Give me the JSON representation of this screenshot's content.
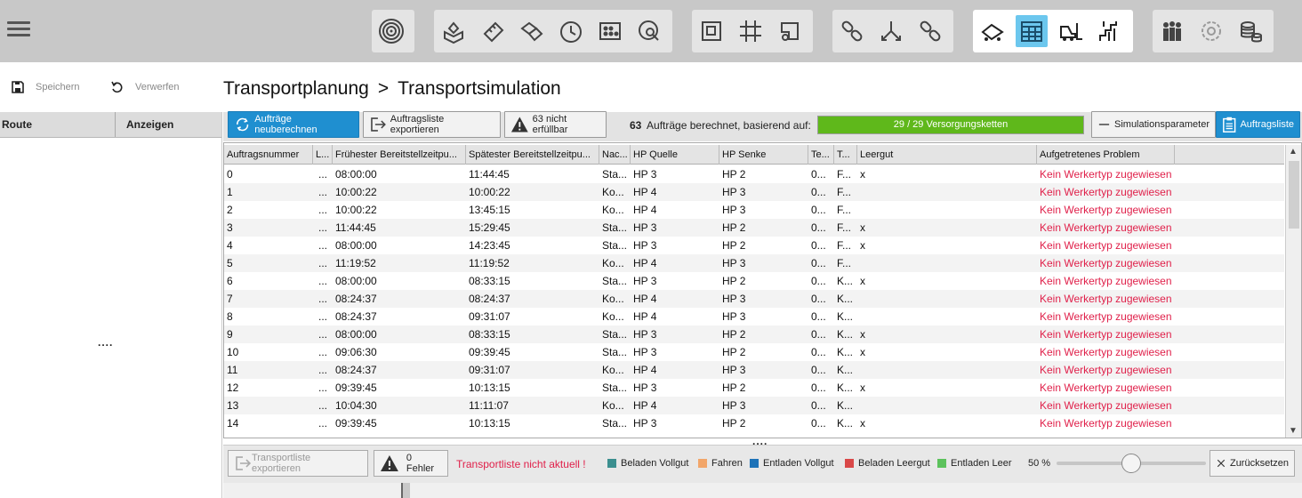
{
  "toolbar": {
    "groups": [
      {
        "icons": [
          "target-icon"
        ]
      },
      {
        "icons": [
          "gift-box-icon",
          "ruler-icon",
          "boxes-icon",
          "clock-icon",
          "grid-dots-icon",
          "cycle-magnifier-icon"
        ]
      },
      {
        "icons": [
          "floorplan-icon",
          "grid-hash-icon",
          "route-frame-icon"
        ]
      },
      {
        "icons": [
          "chain-link-icon",
          "branch-arrows-icon",
          "chain-link-2-icon"
        ]
      },
      {
        "icons": [
          "conveyor-icon",
          "calendar-table-icon",
          "forklift-icon",
          "stairs-icon"
        ],
        "active": "calendar-table-icon"
      },
      {
        "icons": [
          "people-group-icon",
          "gear-faded-icon",
          "stack-coins-icon"
        ]
      }
    ]
  },
  "actions": {
    "save_label": "Speichern",
    "discard_label": "Verwerfen"
  },
  "breadcrumb": {
    "parent": "Transportplanung",
    "separator": ">",
    "current": "Transportsimulation"
  },
  "sidebar": {
    "col_route": "Route",
    "col_show": "Anzeigen",
    "dots": "...."
  },
  "toolrow": {
    "recalc_label": "Aufträge neuberechnen",
    "export_label": "Auftragsliste exportieren",
    "unfulfilled_label": "63 nicht erfüllbar",
    "calc_count": "63",
    "calc_text": "Aufträge berechnet, basierend auf:",
    "progress_label": "29 / 29 Versorgungsketten",
    "progress_fraction": 1.0,
    "sim_params_label": "Simulationsparameter",
    "order_list_label": "Auftragsliste"
  },
  "table": {
    "headers": [
      "Auftragsnummer",
      "L...",
      "Frühester Bereitstellzeitpu...",
      "Spätester Bereitstellzeitpu...",
      "Nac...",
      "HP Quelle",
      "HP Senke",
      "Te...",
      "T...",
      "Leergut",
      "Aufgetretenes Problem"
    ],
    "rows": [
      [
        "0",
        "...",
        "08:00:00",
        "11:44:45",
        "Sta...",
        "HP 3",
        "HP 2",
        "0...",
        "F...",
        "x",
        "Kein Werkertyp zugewiesen"
      ],
      [
        "1",
        "...",
        "10:00:22",
        "10:00:22",
        "Ko...",
        "HP 4",
        "HP 3",
        "0...",
        "F...",
        "",
        "Kein Werkertyp zugewiesen"
      ],
      [
        "2",
        "...",
        "10:00:22",
        "13:45:15",
        "Ko...",
        "HP 4",
        "HP 3",
        "0...",
        "F...",
        "",
        "Kein Werkertyp zugewiesen"
      ],
      [
        "3",
        "...",
        "11:44:45",
        "15:29:45",
        "Sta...",
        "HP 3",
        "HP 2",
        "0...",
        "F...",
        "x",
        "Kein Werkertyp zugewiesen"
      ],
      [
        "4",
        "...",
        "08:00:00",
        "14:23:45",
        "Sta...",
        "HP 3",
        "HP 2",
        "0...",
        "F...",
        "x",
        "Kein Werkertyp zugewiesen"
      ],
      [
        "5",
        "...",
        "11:19:52",
        "11:19:52",
        "Ko...",
        "HP 4",
        "HP 3",
        "0...",
        "F...",
        "",
        "Kein Werkertyp zugewiesen"
      ],
      [
        "6",
        "...",
        "08:00:00",
        "08:33:15",
        "Sta...",
        "HP 3",
        "HP 2",
        "0...",
        "K...",
        "x",
        "Kein Werkertyp zugewiesen"
      ],
      [
        "7",
        "...",
        "08:24:37",
        "08:24:37",
        "Ko...",
        "HP 4",
        "HP 3",
        "0...",
        "K...",
        "",
        "Kein Werkertyp zugewiesen"
      ],
      [
        "8",
        "...",
        "08:24:37",
        "09:31:07",
        "Ko...",
        "HP 4",
        "HP 3",
        "0...",
        "K...",
        "",
        "Kein Werkertyp zugewiesen"
      ],
      [
        "9",
        "...",
        "08:00:00",
        "08:33:15",
        "Sta...",
        "HP 3",
        "HP 2",
        "0...",
        "K...",
        "x",
        "Kein Werkertyp zugewiesen"
      ],
      [
        "10",
        "...",
        "09:06:30",
        "09:39:45",
        "Sta...",
        "HP 3",
        "HP 2",
        "0...",
        "K...",
        "x",
        "Kein Werkertyp zugewiesen"
      ],
      [
        "11",
        "...",
        "08:24:37",
        "09:31:07",
        "Ko...",
        "HP 4",
        "HP 3",
        "0...",
        "K...",
        "",
        "Kein Werkertyp zugewiesen"
      ],
      [
        "12",
        "...",
        "09:39:45",
        "10:13:15",
        "Sta...",
        "HP 3",
        "HP 2",
        "0...",
        "K...",
        "x",
        "Kein Werkertyp zugewiesen"
      ],
      [
        "13",
        "...",
        "10:04:30",
        "11:11:07",
        "Ko...",
        "HP 4",
        "HP 3",
        "0...",
        "K...",
        "",
        "Kein Werkertyp zugewiesen"
      ],
      [
        "14",
        "...",
        "09:39:45",
        "10:13:15",
        "Sta...",
        "HP 3",
        "HP 2",
        "0...",
        "K...",
        "x",
        "Kein Werkertyp zugewiesen"
      ]
    ]
  },
  "split_dots": "....",
  "bottom": {
    "export_transport_label": "Transportliste exportieren",
    "errors_label": "0 Fehler",
    "warning": "Transportliste nicht aktuell !",
    "legend": [
      {
        "label": "Beladen Vollgut",
        "color": "#3b8f8f"
      },
      {
        "label": "Fahren",
        "color": "#f2a66a"
      },
      {
        "label": "Entladen Vollgut",
        "color": "#1e73b8"
      },
      {
        "label": "Beladen Leergut",
        "color": "#d94848"
      },
      {
        "label": "Entladen Leer",
        "color": "#5cc25c"
      }
    ],
    "zoom_label": "50 %",
    "zoom_value": 0.5,
    "reset_label": "Zurücksetzen"
  },
  "colors": {
    "accent": "#1f8fd0",
    "active_tool": "#6cc7ee",
    "error": "#e0204a",
    "progress": "#5fb81b"
  }
}
